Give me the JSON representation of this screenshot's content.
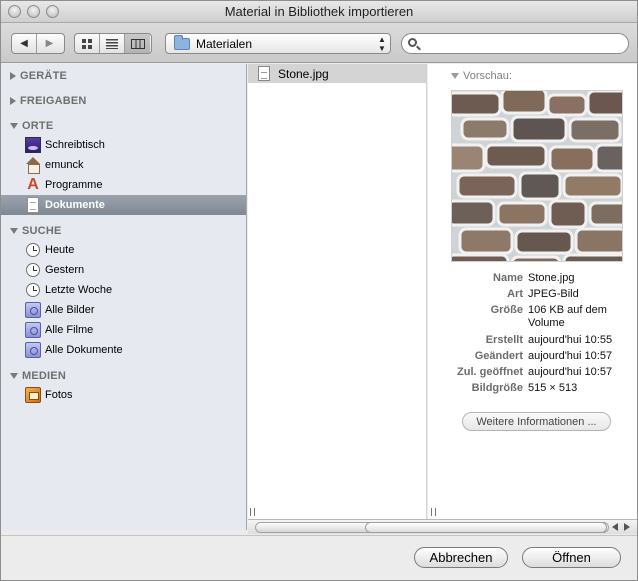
{
  "window": {
    "title": "Material in Bibliothek importieren"
  },
  "toolbar": {
    "back_icon": "back-arrow-icon",
    "forward_icon": "forward-arrow-icon",
    "view_modes": [
      "icon-view",
      "list-view",
      "column-view"
    ],
    "active_view": "column-view",
    "location": "Materialen",
    "search_placeholder": ""
  },
  "sidebar": {
    "sections": [
      {
        "label": "GERÄTE",
        "expanded": false
      },
      {
        "label": "FREIGABEN",
        "expanded": false
      },
      {
        "label": "ORTE",
        "expanded": true,
        "items": [
          {
            "label": "Schreibtisch",
            "icon": "desktop-icon"
          },
          {
            "label": "emunck",
            "icon": "home-icon"
          },
          {
            "label": "Programme",
            "icon": "applications-icon"
          },
          {
            "label": "Dokumente",
            "icon": "document-icon",
            "selected": true
          }
        ]
      },
      {
        "label": "SUCHE",
        "expanded": true,
        "items": [
          {
            "label": "Heute",
            "icon": "clock-icon"
          },
          {
            "label": "Gestern",
            "icon": "clock-icon"
          },
          {
            "label": "Letzte Woche",
            "icon": "clock-icon"
          },
          {
            "label": "Alle Bilder",
            "icon": "smart-folder-icon"
          },
          {
            "label": "Alle Filme",
            "icon": "smart-folder-icon"
          },
          {
            "label": "Alle Dokumente",
            "icon": "smart-folder-icon"
          }
        ]
      },
      {
        "label": "MEDIEN",
        "expanded": true,
        "items": [
          {
            "label": "Fotos",
            "icon": "photos-icon"
          }
        ]
      }
    ]
  },
  "file_list": {
    "items": [
      {
        "name": "Stone.jpg",
        "selected": true
      }
    ]
  },
  "preview": {
    "header": "Vorschau:",
    "info": [
      {
        "key": "Name",
        "value": "Stone.jpg"
      },
      {
        "key": "Art",
        "value": "JPEG-Bild"
      },
      {
        "key": "Größe",
        "value": "106 KB auf dem Volume"
      },
      {
        "key": "Erstellt",
        "value": "aujourd'hui 10:55"
      },
      {
        "key": "Geändert",
        "value": "aujourd'hui 10:57"
      },
      {
        "key": "Zul. geöffnet",
        "value": "aujourd'hui 10:57"
      },
      {
        "key": "Bildgröße",
        "value": "515 × 513"
      }
    ],
    "more_info_label": "Weitere Informationen ..."
  },
  "buttons": {
    "cancel": "Abbrechen",
    "open": "Öffnen"
  }
}
